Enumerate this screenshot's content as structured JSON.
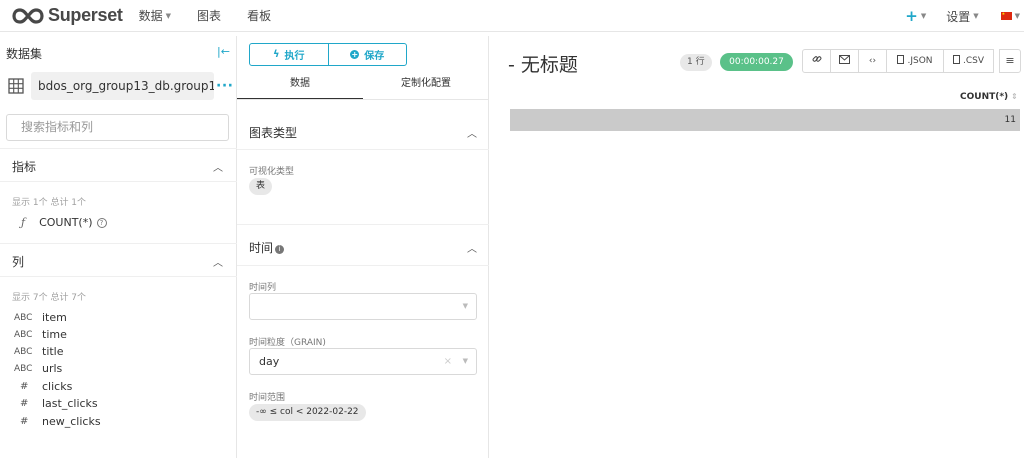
{
  "nav": {
    "brand": "Superset",
    "menu": [
      {
        "label": "数据",
        "caret": true
      },
      {
        "label": "图表",
        "caret": false
      },
      {
        "label": "看板",
        "caret": false
      }
    ],
    "settings": "设置"
  },
  "left_panel": {
    "title": "数据集",
    "dataset_name": "bdos_org_group13_db.group1...",
    "search_placeholder": "搜索指标和列",
    "metrics": {
      "title": "指标",
      "count_note": "显示 1个 总计 1个",
      "items": [
        "COUNT(*)"
      ]
    },
    "columns": {
      "title": "列",
      "count_note": "显示 7个 总计 7个",
      "items": [
        {
          "type": "ABC",
          "name": "item"
        },
        {
          "type": "ABC",
          "name": "time"
        },
        {
          "type": "ABC",
          "name": "title"
        },
        {
          "type": "ABC",
          "name": "urls"
        },
        {
          "type": "#",
          "name": "clicks"
        },
        {
          "type": "#",
          "name": "last_clicks"
        },
        {
          "type": "#",
          "name": "new_clicks"
        }
      ]
    }
  },
  "middle_panel": {
    "run_label": "执行",
    "save_label": "保存",
    "tabs": [
      "数据",
      "定制化配置"
    ],
    "chart_type_section": "图表类型",
    "viz_type_label": "可视化类型",
    "viz_type_value": "表",
    "time_section": "时间",
    "time_column_label": "时间列",
    "time_grain_label": "时间粒度（GRAIN)",
    "time_grain_value": "day",
    "time_range_label": "时间范围",
    "time_range_value": "-∞ ≤ col < 2022-02-22"
  },
  "right_panel": {
    "chart_title": "- 无标题",
    "rows_badge": "1 行",
    "timer": "00:00:00.27",
    "json_label": ".JSON",
    "csv_label": ".CSV",
    "column_header": "COUNT(*)",
    "value": "11",
    "value_fill": 1.0
  },
  "colors": {
    "accent": "#20a7c9",
    "success": "#5ac189",
    "bar": "#cacaca"
  }
}
